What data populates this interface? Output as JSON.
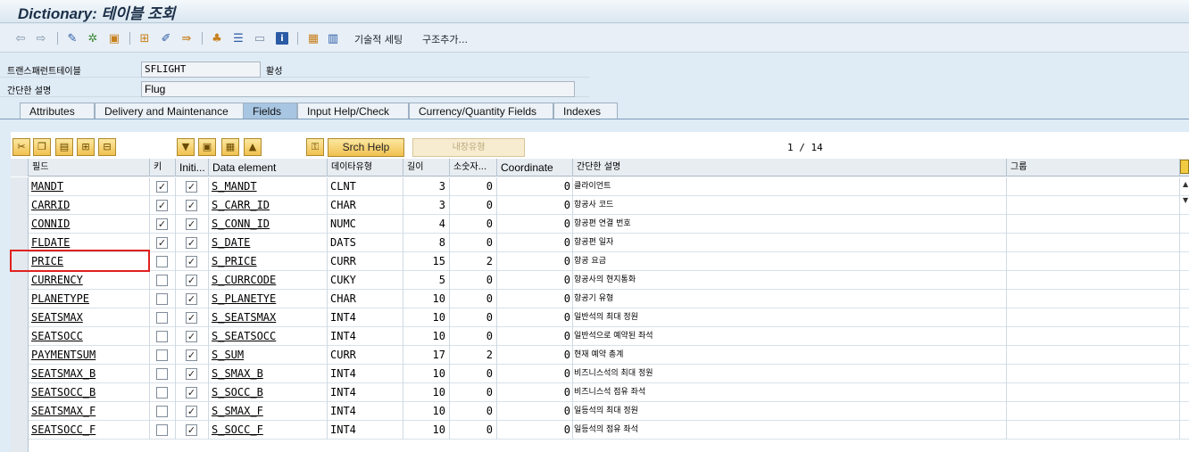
{
  "window": {
    "title": "Dictionary: 테이블 조회"
  },
  "toolbar": {
    "text_buttons": [
      "기술적 세팅",
      "구조추가..."
    ]
  },
  "header": {
    "table_label": "트랜스패런트테이블",
    "table_value": "SFLIGHT",
    "table_status": "활성",
    "short_desc_label": "간단한 설명",
    "short_desc_value": "Flug"
  },
  "tabs": [
    {
      "label": "Attributes",
      "active": false
    },
    {
      "label": "Delivery and Maintenance",
      "active": false
    },
    {
      "label": "Fields",
      "active": true
    },
    {
      "label": "Input Help/Check",
      "active": false
    },
    {
      "label": "Currency/Quantity Fields",
      "active": false
    },
    {
      "label": "Indexes",
      "active": false
    }
  ],
  "field_toolbar": {
    "srch_help_label": "Srch Help",
    "builtin_type_label": "내장유형",
    "page_indicator": "1 / 14"
  },
  "grid": {
    "columns": [
      "필드",
      "키",
      "Initi...",
      "Data element",
      "데이타유형",
      "길이",
      "소숫자...",
      "Coordinate",
      "간단한 설명",
      "그룹"
    ],
    "rows": [
      {
        "field": "MANDT",
        "key": true,
        "init": true,
        "element": "S_MANDT",
        "type": "CLNT",
        "len": "3",
        "dec": "0",
        "coord": "0",
        "desc": "클라이언트"
      },
      {
        "field": "CARRID",
        "key": true,
        "init": true,
        "element": "S_CARR_ID",
        "type": "CHAR",
        "len": "3",
        "dec": "0",
        "coord": "0",
        "desc": "항공사 코드"
      },
      {
        "field": "CONNID",
        "key": true,
        "init": true,
        "element": "S_CONN_ID",
        "type": "NUMC",
        "len": "4",
        "dec": "0",
        "coord": "0",
        "desc": "항공편 연결 번호"
      },
      {
        "field": "FLDATE",
        "key": true,
        "init": true,
        "element": "S_DATE",
        "type": "DATS",
        "len": "8",
        "dec": "0",
        "coord": "0",
        "desc": "항공편 일자"
      },
      {
        "field": "PRICE",
        "key": false,
        "init": true,
        "element": "S_PRICE",
        "type": "CURR",
        "len": "15",
        "dec": "2",
        "coord": "0",
        "desc": "항공 요금"
      },
      {
        "field": "CURRENCY",
        "key": false,
        "init": true,
        "element": "S_CURRCODE",
        "type": "CUKY",
        "len": "5",
        "dec": "0",
        "coord": "0",
        "desc": "항공사의 현지통화"
      },
      {
        "field": "PLANETYPE",
        "key": false,
        "init": true,
        "element": "S_PLANETYE",
        "type": "CHAR",
        "len": "10",
        "dec": "0",
        "coord": "0",
        "desc": "항공기 유형"
      },
      {
        "field": "SEATSMAX",
        "key": false,
        "init": true,
        "element": "S_SEATSMAX",
        "type": "INT4",
        "len": "10",
        "dec": "0",
        "coord": "0",
        "desc": "일반석의 최대 정원"
      },
      {
        "field": "SEATSOCC",
        "key": false,
        "init": true,
        "element": "S_SEATSOCC",
        "type": "INT4",
        "len": "10",
        "dec": "0",
        "coord": "0",
        "desc": "일반석으로 예약된 좌석"
      },
      {
        "field": "PAYMENTSUM",
        "key": false,
        "init": true,
        "element": "S_SUM",
        "type": "CURR",
        "len": "17",
        "dec": "2",
        "coord": "0",
        "desc": "현재 예약 총계"
      },
      {
        "field": "SEATSMAX_B",
        "key": false,
        "init": true,
        "element": "S_SMAX_B",
        "type": "INT4",
        "len": "10",
        "dec": "0",
        "coord": "0",
        "desc": "비즈니스석의 최대 정원"
      },
      {
        "field": "SEATSOCC_B",
        "key": false,
        "init": true,
        "element": "S_SOCC_B",
        "type": "INT4",
        "len": "10",
        "dec": "0",
        "coord": "0",
        "desc": "비즈니스석 점유 좌석"
      },
      {
        "field": "SEATSMAX_F",
        "key": false,
        "init": true,
        "element": "S_SMAX_F",
        "type": "INT4",
        "len": "10",
        "dec": "0",
        "coord": "0",
        "desc": "일등석의 최대 정원"
      },
      {
        "field": "SEATSOCC_F",
        "key": false,
        "init": true,
        "element": "S_SOCC_F",
        "type": "INT4",
        "len": "10",
        "dec": "0",
        "coord": "0",
        "desc": "일등석의 점유 좌석"
      }
    ]
  },
  "highlight": {
    "row_field": "PRICE",
    "color": "#e0211f"
  }
}
